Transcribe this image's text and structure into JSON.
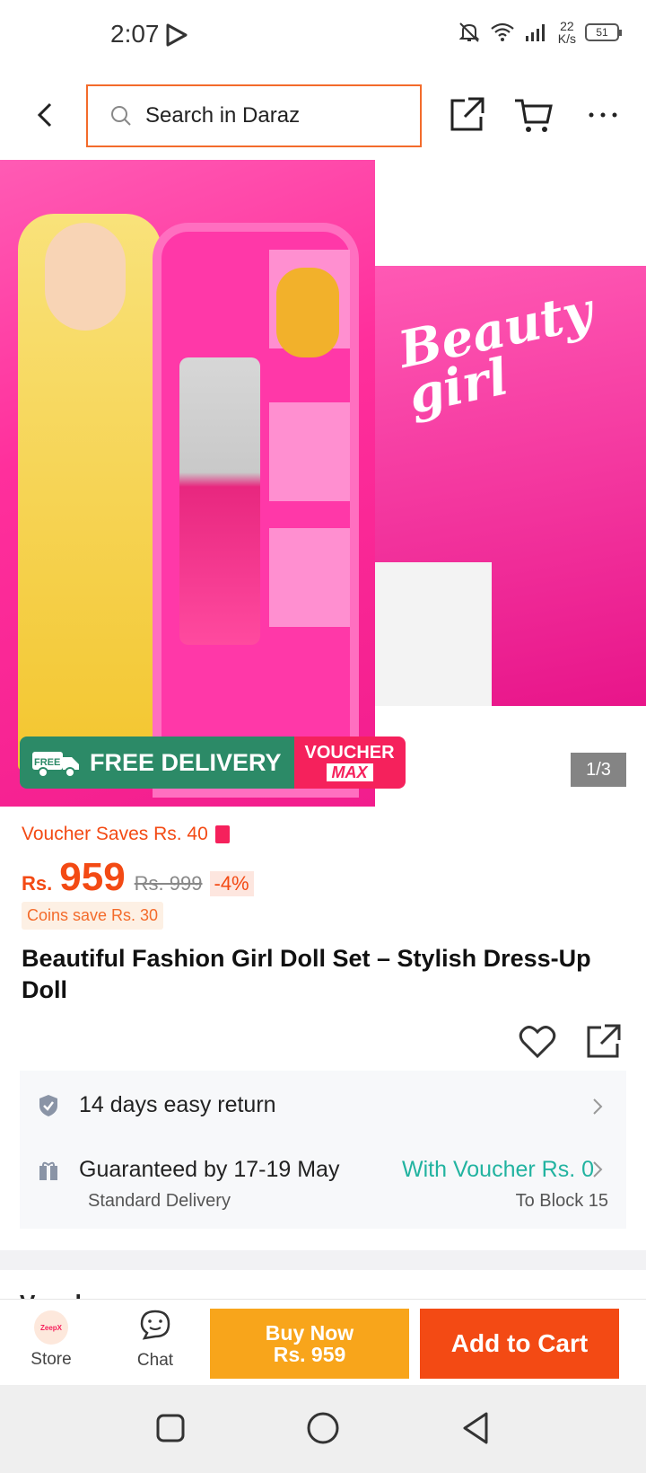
{
  "status_bar": {
    "time": "2:07",
    "speed_value": "22",
    "speed_unit": "K/s",
    "battery": "51"
  },
  "header": {
    "search_placeholder": "Search in Daraz"
  },
  "gallery": {
    "image_counter": "1/3",
    "right_image_text": "Beauty girl",
    "badge_free_delivery": "FREE DELIVERY",
    "badge_free_small": "FREE",
    "badge_voucher": "VOUCHER",
    "badge_voucher_max": "MAX"
  },
  "pricing": {
    "voucher_saves": "Voucher Saves Rs. 40",
    "currency": "Rs.",
    "price": "959",
    "original_price": "Rs. 999",
    "discount": "-4%",
    "coins_save": "Coins save Rs. 30"
  },
  "product": {
    "title": "Beautiful Fashion Girl Doll Set – Stylish Dress-Up Doll"
  },
  "service": {
    "return_text": "14 days easy return",
    "delivery_guarantee": "Guaranteed by 17-19 May",
    "delivery_type": "Standard Delivery",
    "voucher_text": "With Voucher Rs. 0",
    "location": "To Block 15"
  },
  "next_section_partial": "Vouchers",
  "action_bar": {
    "store_label": "Store",
    "store_logo_text": "ZeepX",
    "chat_label": "Chat",
    "buy_now_label": "Buy Now",
    "buy_now_price": "Rs. 959",
    "add_to_cart_label": "Add to Cart"
  },
  "colors": {
    "accent": "#f34a14",
    "buy_now": "#f8a51b",
    "free_delivery": "#2c8a67",
    "voucher": "#f5215c",
    "teal": "#22b3a0"
  },
  "icons": [
    "back-icon",
    "search-icon",
    "share-icon",
    "cart-icon",
    "more-icon",
    "heart-icon",
    "shield-icon",
    "gift-icon",
    "chevron-right-icon",
    "chat-icon"
  ]
}
